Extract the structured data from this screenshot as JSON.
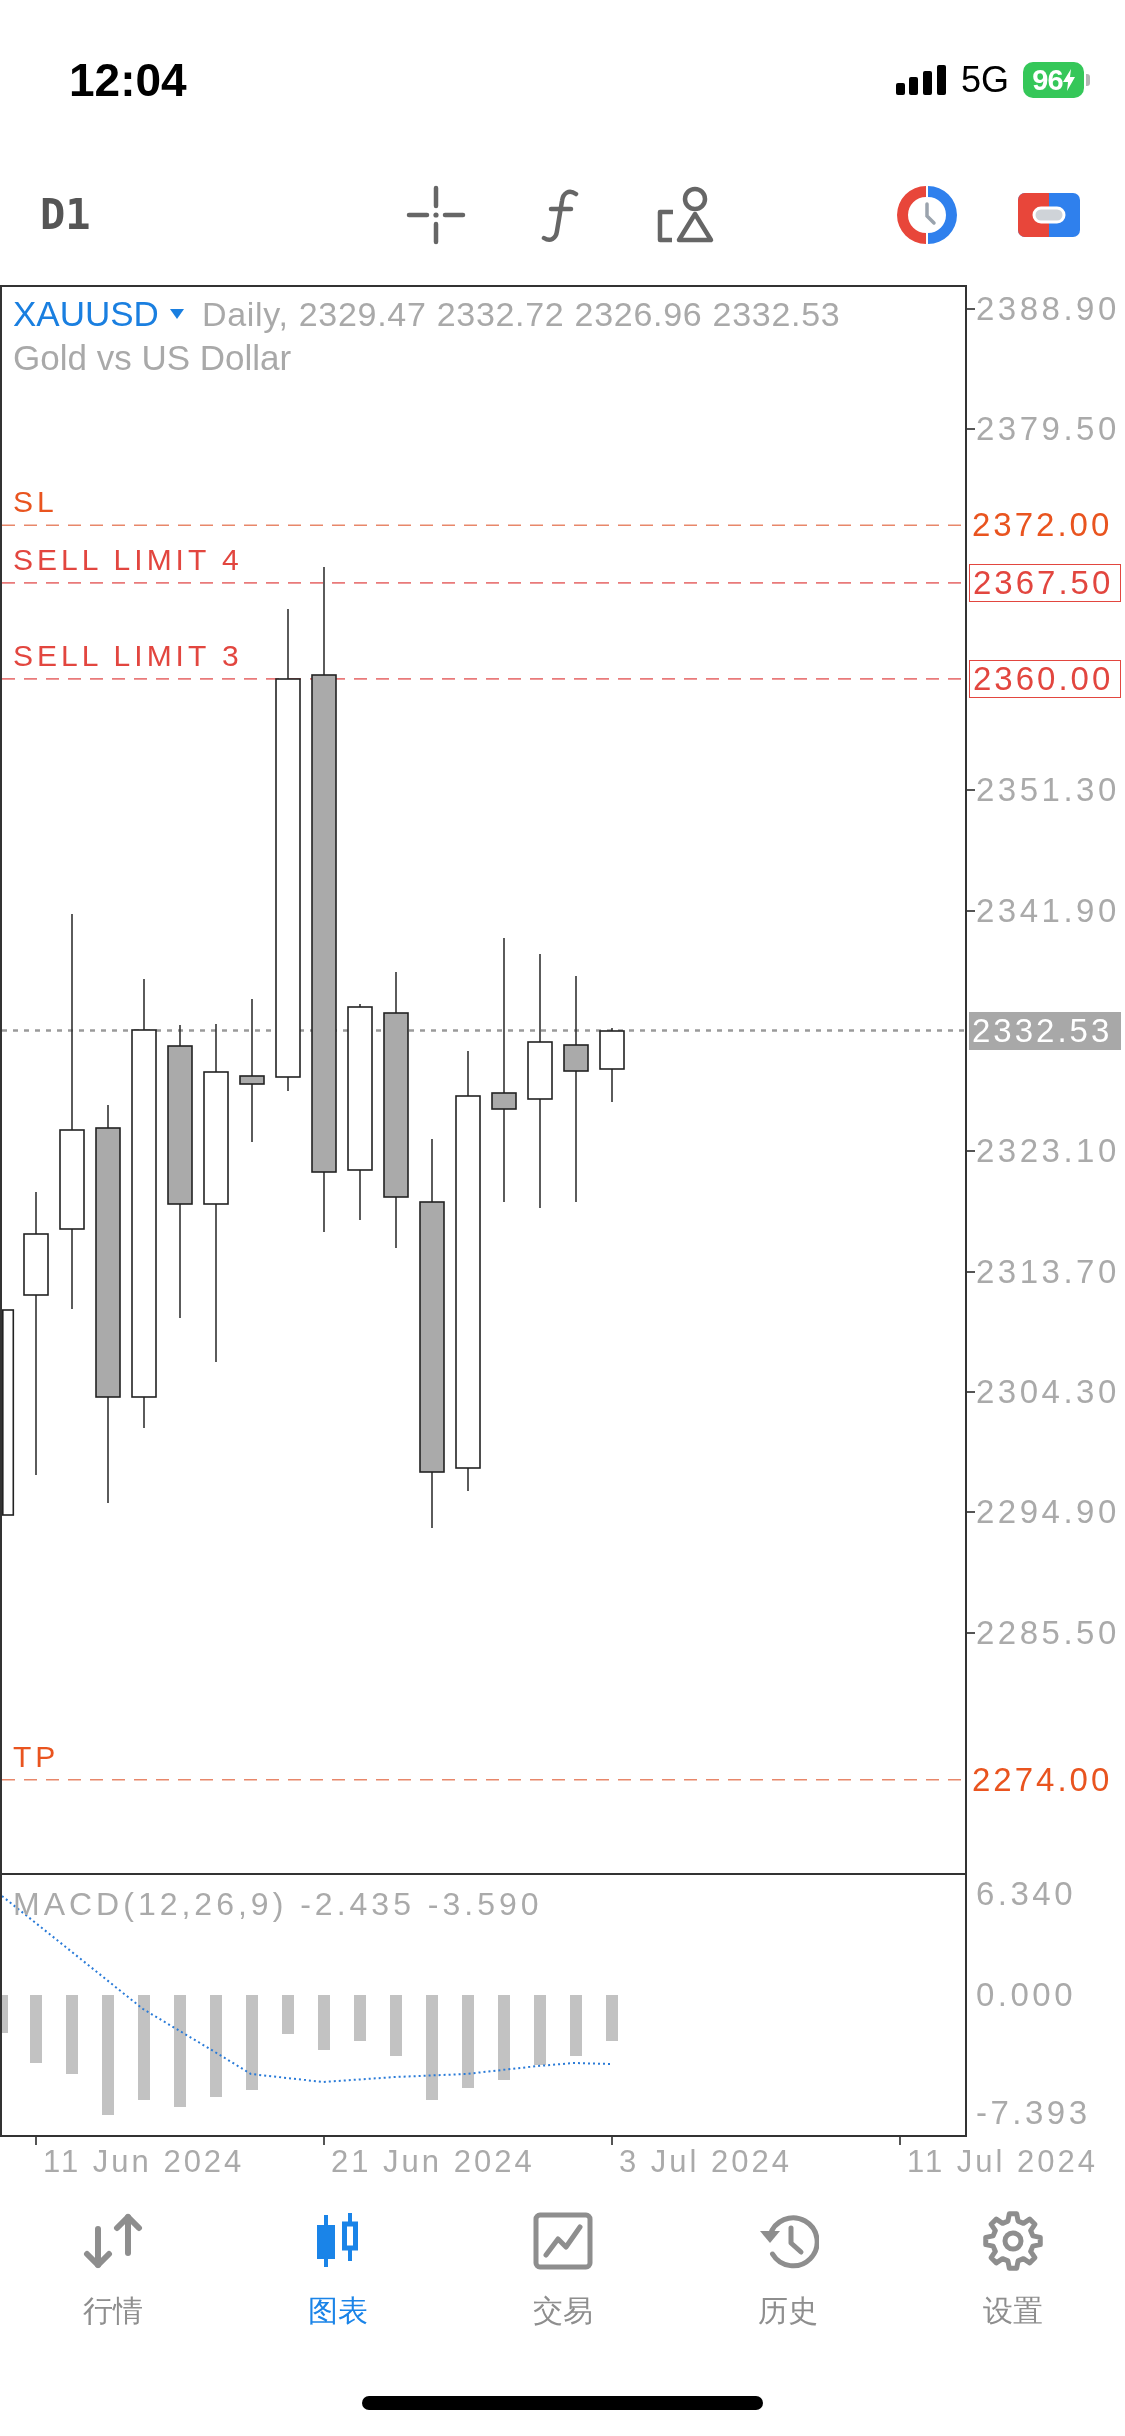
{
  "status_bar": {
    "time": "12:04",
    "network": "5G",
    "battery": "96"
  },
  "toolbar": {
    "timeframe": "D1"
  },
  "chart": {
    "symbol": "XAUUSD",
    "quote": "Daily, 2329.47 2332.72 2326.96 2332.53",
    "description": "Gold vs US Dollar",
    "price_axis": [
      "2388.90",
      "2379.50",
      "2351.30",
      "2341.90",
      "2323.10",
      "2313.70",
      "2304.30",
      "2294.90",
      "2285.50"
    ],
    "order_lines": [
      {
        "kind": "stop",
        "label": "SL",
        "price": "2372.00"
      },
      {
        "kind": "pending",
        "label": "SELL LIMIT 4",
        "price": "2367.50"
      },
      {
        "kind": "pending",
        "label": "SELL LIMIT 3",
        "price": "2360.00"
      },
      {
        "kind": "stop",
        "label": "TP",
        "price": "2274.00"
      }
    ],
    "current_price": "2332.53"
  },
  "macd": {
    "title": "MACD(12,26,9) -2.435 -3.590",
    "axis": [
      "6.340",
      "0.000",
      "-7.393"
    ]
  },
  "time_axis": [
    "11 Jun 2024",
    "21 Jun 2024",
    "3 Jul 2024",
    "11 Jul 2024"
  ],
  "tab_bar": [
    {
      "label": "行情",
      "selected": false
    },
    {
      "label": "图表",
      "selected": true
    },
    {
      "label": "交易",
      "selected": false
    },
    {
      "label": "历史",
      "selected": false
    },
    {
      "label": "设置",
      "selected": false
    }
  ]
}
